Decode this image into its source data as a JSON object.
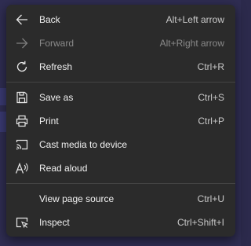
{
  "menu": {
    "items": [
      {
        "label": "Back",
        "shortcut": "Alt+Left arrow",
        "icon": "arrow-left-icon",
        "enabled": true
      },
      {
        "label": "Forward",
        "shortcut": "Alt+Right arrow",
        "icon": "arrow-right-icon",
        "enabled": false
      },
      {
        "label": "Refresh",
        "shortcut": "Ctrl+R",
        "icon": "refresh-icon",
        "enabled": true
      },
      {
        "label": "Save as",
        "shortcut": "Ctrl+S",
        "icon": "save-icon",
        "enabled": true
      },
      {
        "label": "Print",
        "shortcut": "Ctrl+P",
        "icon": "printer-icon",
        "enabled": true
      },
      {
        "label": "Cast media to device",
        "shortcut": "",
        "icon": "cast-icon",
        "enabled": true
      },
      {
        "label": "Read aloud",
        "shortcut": "",
        "icon": "read-aloud-icon",
        "enabled": true
      },
      {
        "label": "View page source",
        "shortcut": "Ctrl+U",
        "icon": "",
        "enabled": true
      },
      {
        "label": "Inspect",
        "shortcut": "Ctrl+Shift+I",
        "icon": "inspect-icon",
        "enabled": true
      }
    ]
  },
  "colors": {
    "menu_background": "#2b2b2b",
    "text": "#f1f1f1",
    "disabled_text": "#8a8a8a",
    "page_background": "#2f2d52"
  }
}
